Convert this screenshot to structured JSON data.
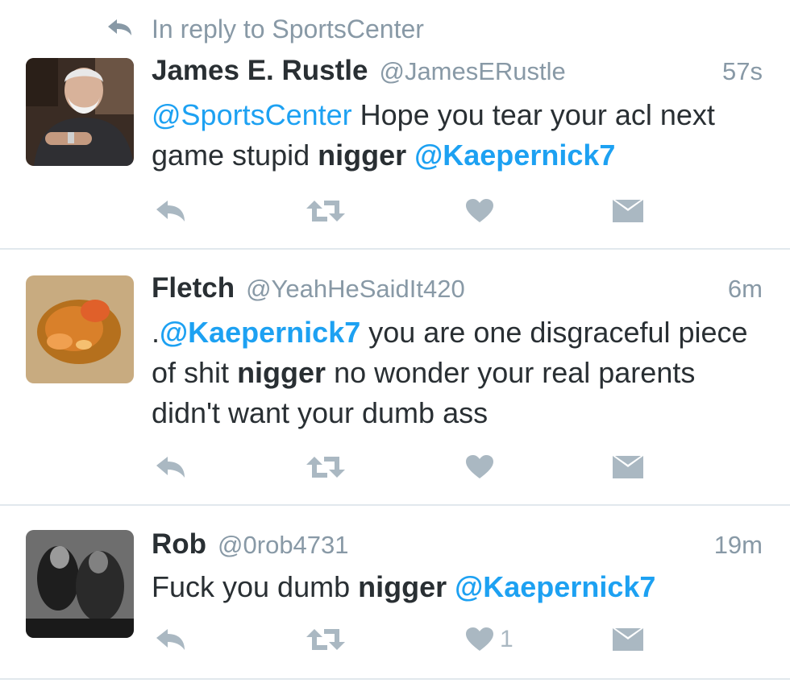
{
  "context": {
    "text": "In reply to SportsCenter"
  },
  "tweets": [
    {
      "name": "James E. Rustle",
      "handle": "@JamesERustle",
      "time": "57s",
      "body": [
        {
          "t": "@SportsCenter",
          "k": "mention"
        },
        {
          "t": " Hope you tear your acl next game stupid ",
          "k": "text"
        },
        {
          "t": "nigger",
          "k": "bold"
        },
        {
          "t": " ",
          "k": "text"
        },
        {
          "t": "@Kaepernick7",
          "k": "mention-bold"
        }
      ],
      "like_count": ""
    },
    {
      "name": "Fletch",
      "handle": "@YeahHeSaidIt420",
      "time": "6m",
      "body": [
        {
          "t": ".",
          "k": "text"
        },
        {
          "t": "@Kaepernick7",
          "k": "mention-bold"
        },
        {
          "t": " you are one disgraceful piece of shit ",
          "k": "text"
        },
        {
          "t": "nigger",
          "k": "bold"
        },
        {
          "t": " no wonder your real parents didn't want your dumb ass",
          "k": "text"
        }
      ],
      "like_count": ""
    },
    {
      "name": "Rob",
      "handle": "@0rob4731",
      "time": "19m",
      "body": [
        {
          "t": "Fuck you dumb ",
          "k": "text"
        },
        {
          "t": "nigger",
          "k": "bold"
        },
        {
          "t": " ",
          "k": "text"
        },
        {
          "t": "@Kaepernick7",
          "k": "mention-bold"
        }
      ],
      "like_count": "1"
    }
  ],
  "icons": {
    "context": "reply-arrow-icon",
    "reply": "reply-icon",
    "retweet": "retweet-icon",
    "like": "heart-icon",
    "dm": "direct-message-icon"
  },
  "colors": {
    "text": "#292f33",
    "secondary": "#8899a6",
    "link": "#1da1f2",
    "action_icon": "#aab8c2",
    "divider": "#e1e8ed"
  }
}
